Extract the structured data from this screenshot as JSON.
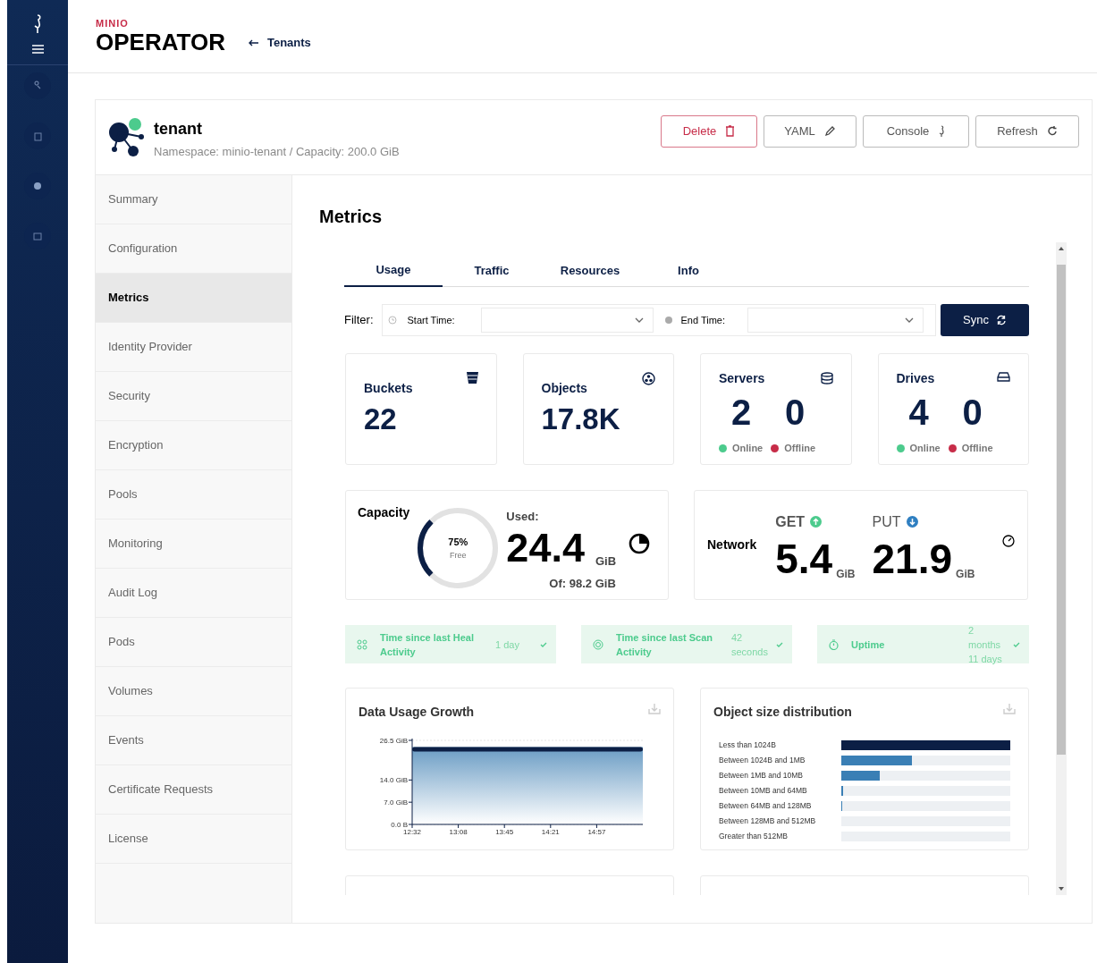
{
  "header": {
    "brand_top": "MINIO",
    "brand": "OPERATOR",
    "back_link": "Tenants"
  },
  "tenant": {
    "name": "tenant",
    "subtitle": "Namespace: minio-tenant / Capacity: 200.0 GiB"
  },
  "actions": [
    {
      "label": "Delete",
      "kind": "delete"
    },
    {
      "label": "YAML",
      "kind": "yaml"
    },
    {
      "label": "Console",
      "kind": "console"
    },
    {
      "label": "Refresh",
      "kind": "refresh"
    }
  ],
  "nav": [
    {
      "label": "Summary",
      "selected": false
    },
    {
      "label": "Configuration",
      "selected": false
    },
    {
      "label": "Metrics",
      "selected": true
    },
    {
      "label": "Identity Provider",
      "selected": false
    },
    {
      "label": "Security",
      "selected": false
    },
    {
      "label": "Encryption",
      "selected": false
    },
    {
      "label": "Pools",
      "selected": false
    },
    {
      "label": "Monitoring",
      "selected": false
    },
    {
      "label": "Audit Log",
      "selected": false
    },
    {
      "label": "Pods",
      "selected": false
    },
    {
      "label": "Volumes",
      "selected": false
    },
    {
      "label": "Events",
      "selected": false
    },
    {
      "label": "Certificate Requests",
      "selected": false
    },
    {
      "label": "License",
      "selected": false
    }
  ],
  "page_title": "Metrics",
  "tabs": [
    {
      "label": "Usage",
      "selected": true
    },
    {
      "label": "Traffic",
      "selected": false
    },
    {
      "label": "Resources",
      "selected": false
    },
    {
      "label": "Info",
      "selected": false
    }
  ],
  "filter": {
    "label": "Filter:",
    "start_label": "Start Time:",
    "end_label": "End Time:",
    "sync": "Sync"
  },
  "stats": [
    {
      "kind": "buckets",
      "title": "Buckets",
      "value": "22"
    },
    {
      "kind": "objects",
      "title": "Objects",
      "value": "17.8K"
    },
    {
      "kind": "servers",
      "title": "Servers",
      "online": "2",
      "offline": "0",
      "online_label": "Online",
      "offline_label": "Offline"
    },
    {
      "kind": "drives",
      "title": "Drives",
      "online": "4",
      "offline": "0",
      "online_label": "Online",
      "offline_label": "Offline"
    }
  ],
  "capacity": {
    "title": "Capacity",
    "level": 0.25,
    "percent": "75%",
    "percent_label": "Free",
    "used_label": "Used:",
    "used": "24.4",
    "used_unit": "GiB",
    "total": "Of: 98.2 GiB"
  },
  "network": {
    "title": "Network",
    "get_label": "GET",
    "get": "5.4",
    "get_unit": "GiB",
    "put_label": "PUT",
    "put": "21.9",
    "put_unit": "GiB"
  },
  "health": [
    {
      "kind": "heal",
      "label": "Time since last Heal Activity",
      "value": "1 day"
    },
    {
      "kind": "scan",
      "label": "Time since last Scan Activity",
      "value": "42 seconds"
    },
    {
      "kind": "uptime",
      "label": "Uptime",
      "value": "2 months 11 days"
    }
  ],
  "usage_chart": {
    "title": "Data Usage Growth",
    "chart_data": {
      "type": "area",
      "categories": [
        "12:32",
        "13:08",
        "13:45",
        "14:21",
        "14:57",
        null
      ],
      "series": [
        {
          "color": "#0c1f45",
          "values": [
            24.4,
            24.4,
            24.4,
            24.4,
            24.4,
            24.4
          ]
        }
      ],
      "ylim": [
        0,
        26.5
      ],
      "yticks": [
        {
          "value": 0,
          "label": "0.0 B"
        },
        {
          "value": 7,
          "label": "7.0 GiB"
        },
        {
          "value": 14,
          "label": "14.0 GiB"
        },
        {
          "value": 26.5,
          "label": "26.5 GiB"
        }
      ]
    }
  },
  "size_chart": {
    "title": "Object size distribution",
    "bars": [
      {
        "label": "Less than 1024B",
        "level": 1,
        "color": "#0c1f45"
      },
      {
        "label": "Between 1024B and 1MB",
        "level": 0.42,
        "color": "#3a7fb5"
      },
      {
        "label": "Between 1MB and 10MB",
        "level": 0.23,
        "color": "#3a7fb5"
      },
      {
        "label": "Between 10MB and 64MB",
        "level": 0.012,
        "color": "#3a7fb5"
      },
      {
        "label": "Between 64MB and 128MB",
        "level": 0.004,
        "color": "#3a7fb5"
      },
      {
        "label": "Between 128MB and 512MB"
      },
      {
        "label": "Greater than 512MB"
      }
    ]
  }
}
